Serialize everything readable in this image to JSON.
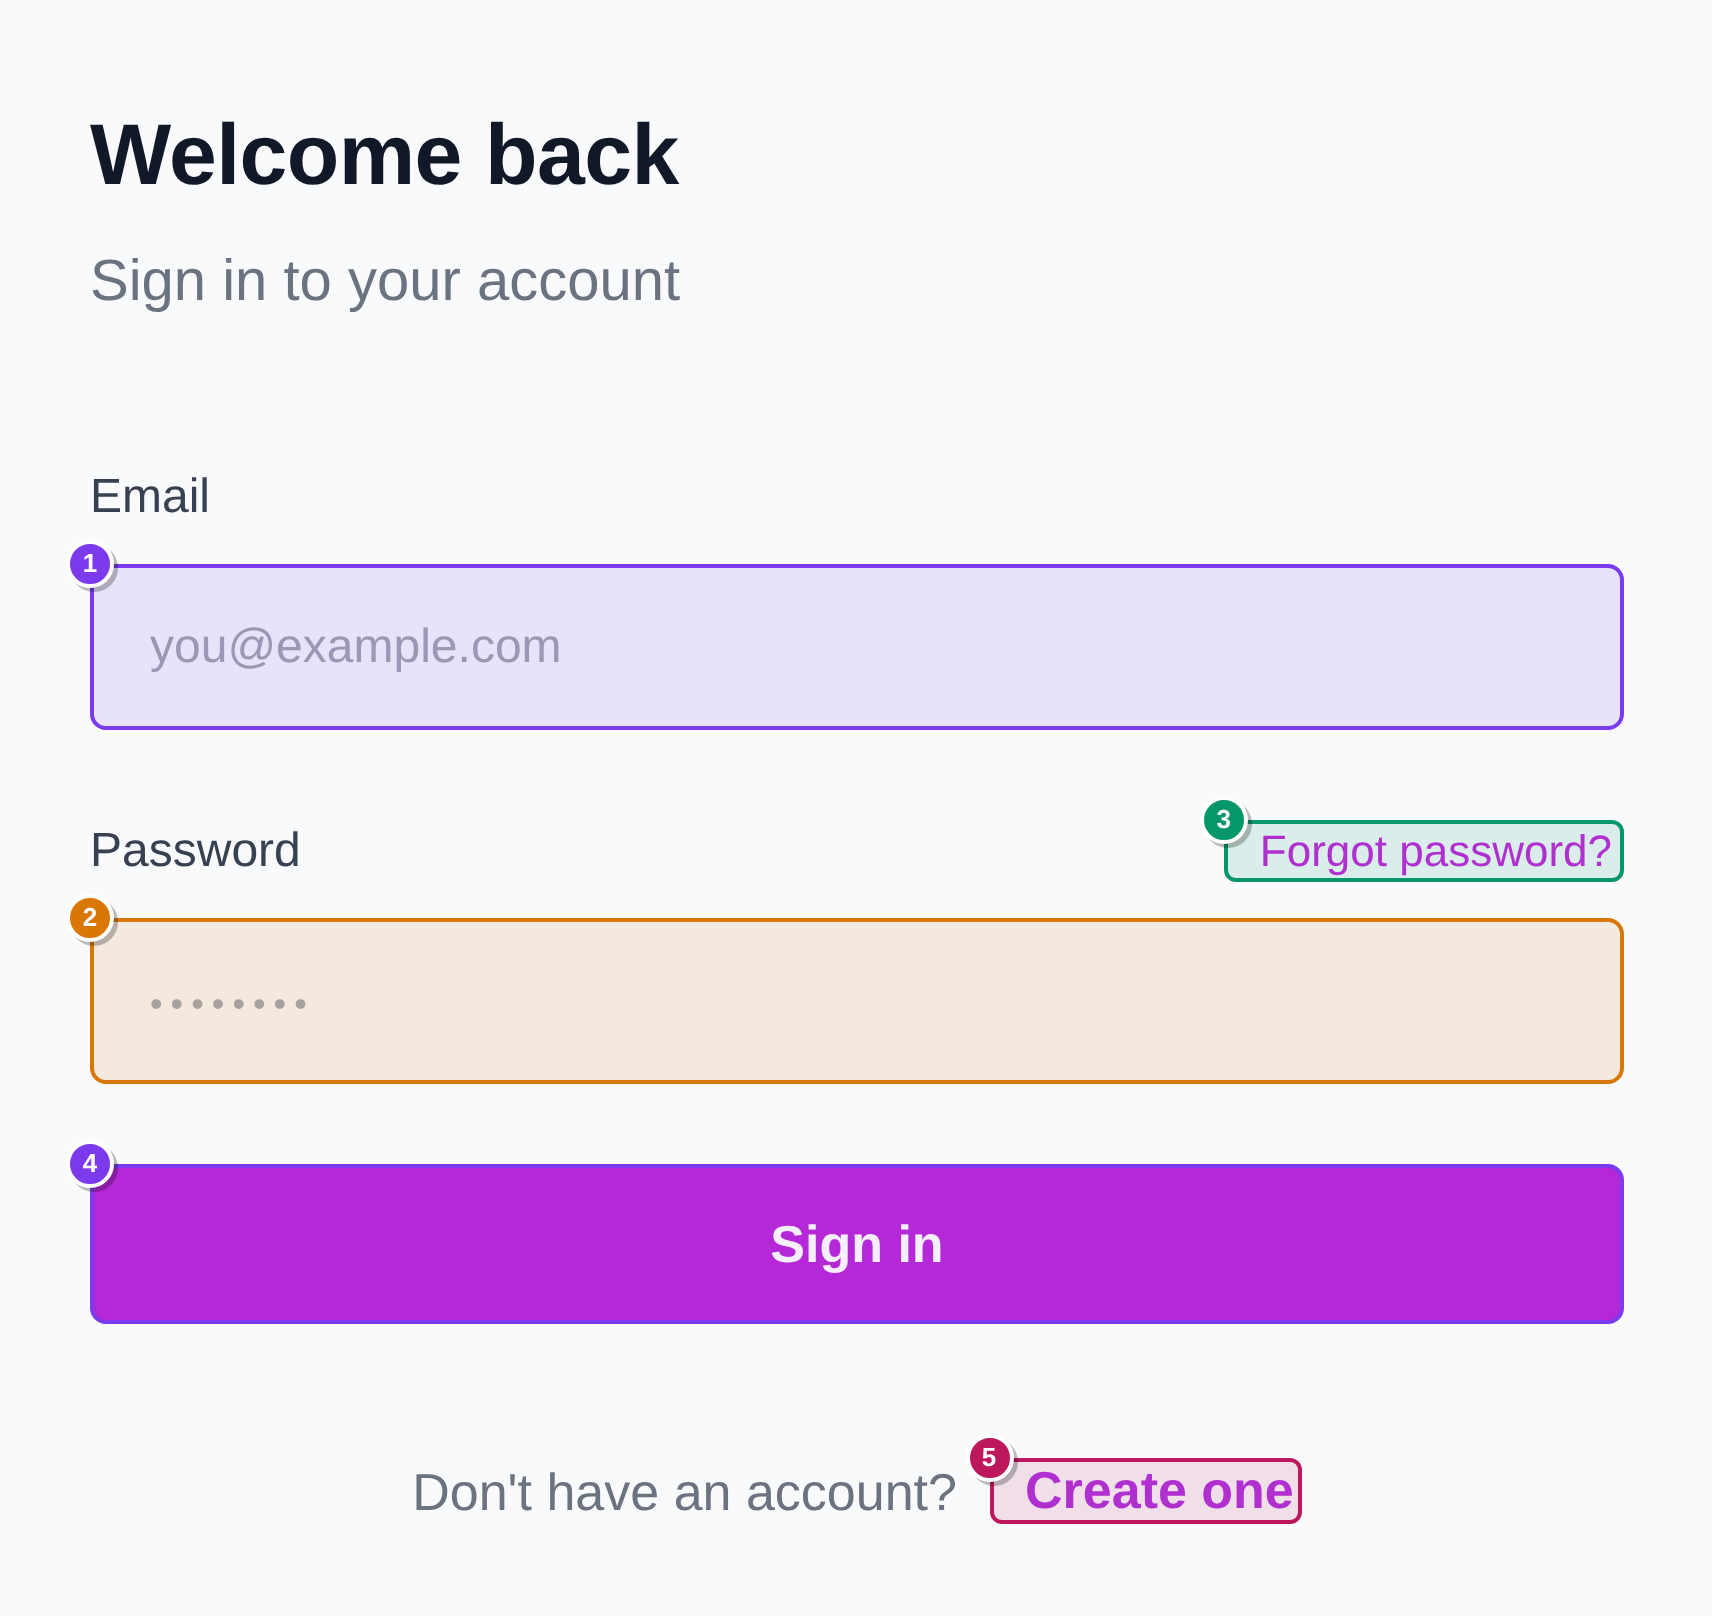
{
  "header": {
    "title": "Welcome back",
    "subtitle": "Sign in to your account"
  },
  "fields": [
    {
      "kind": "email",
      "label": "Email",
      "placeholder": "you@example.com",
      "marker": {
        "number": "1",
        "color": "#7c3aed"
      }
    },
    {
      "kind": "password",
      "label": "Password",
      "placeholder": "••••••••",
      "marker": {
        "number": "2",
        "color": "#d97706"
      },
      "link": {
        "label": "Forgot password?",
        "marker": {
          "number": "3",
          "color": "#059669"
        }
      }
    }
  ],
  "submit": {
    "label": "Sign in",
    "marker": {
      "number": "4",
      "color": "#7c3aed"
    }
  },
  "footer": {
    "text": "Don't have an account?",
    "link": {
      "label": "Create one",
      "marker": {
        "number": "5",
        "color": "#be185d"
      }
    }
  }
}
